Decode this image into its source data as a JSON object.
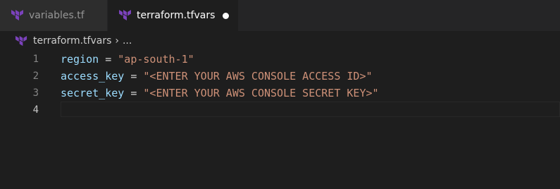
{
  "tabs": [
    {
      "label": "variables.tf",
      "icon": "terraform-icon",
      "active": false
    },
    {
      "label": "terraform.tfvars",
      "icon": "terraform-icon",
      "active": true,
      "unsaved": true
    }
  ],
  "breadcrumb": {
    "file": "terraform.tfvars",
    "separator": "›",
    "more": "..."
  },
  "code_lines": [
    {
      "number": "1",
      "key": "region",
      "op": " = ",
      "value": "\"ap-south-1\""
    },
    {
      "number": "2",
      "key": "access_key",
      "op": " = ",
      "value": "\"<ENTER YOUR AWS CONSOLE ACCESS ID>\""
    },
    {
      "number": "3",
      "key": "secret_key",
      "op": " = ",
      "value": "\"<ENTER YOUR AWS CONSOLE SECRET KEY>\""
    },
    {
      "number": "4",
      "key": "",
      "op": "",
      "value": ""
    }
  ],
  "colors": {
    "terraform_icon": "#7b42bc",
    "key": "#9cdcfe",
    "string": "#ce9178",
    "background": "#1e1e1e"
  }
}
